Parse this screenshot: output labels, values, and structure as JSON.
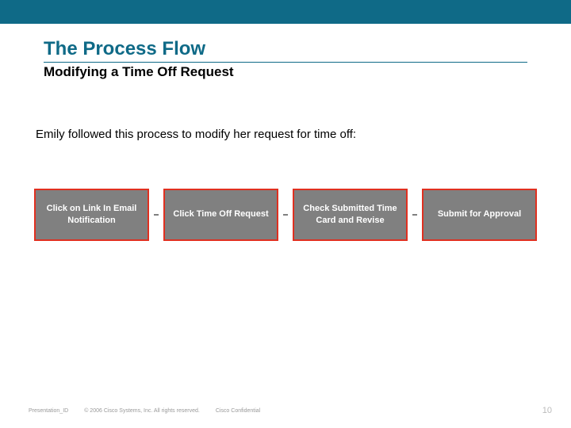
{
  "header": {
    "title": "The Process Flow",
    "subtitle": "Modifying a Time Off Request"
  },
  "body": {
    "intro": "Emily followed this process to modify her request for time off:"
  },
  "flow": {
    "steps": [
      "Click on Link In Email Notification",
      "Click Time Off Request",
      "Check Submitted Time Card and Revise",
      "Submit for Approval"
    ]
  },
  "footer": {
    "presentation_id": "Presentation_ID",
    "copyright": "© 2006 Cisco Systems, Inc. All rights reserved.",
    "confidential": "Cisco Confidential",
    "page_number": "10"
  }
}
